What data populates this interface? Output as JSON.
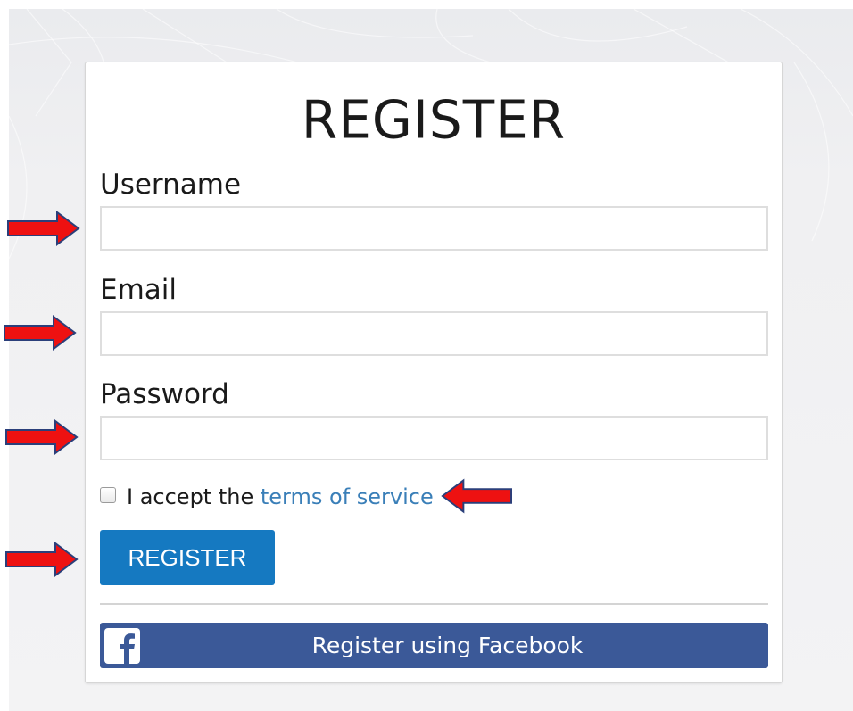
{
  "form": {
    "title": "REGISTER",
    "username_label": "Username",
    "username_value": "",
    "email_label": "Email",
    "email_value": "",
    "password_label": "Password",
    "password_value": "",
    "terms_prefix": "I accept the ",
    "terms_link": "terms of service",
    "terms_checked": false,
    "register_button": "REGISTER",
    "facebook_button": "Register using Facebook"
  },
  "icons": {
    "facebook": "facebook-logo-icon",
    "annotation_arrow": "red-arrow-icon"
  },
  "colors": {
    "primary_button": "#1579c1",
    "facebook": "#3b5998",
    "link": "#3a7fb8",
    "annotation_arrow": "#ee1111",
    "annotation_arrow_outline": "#2b3f7a"
  }
}
